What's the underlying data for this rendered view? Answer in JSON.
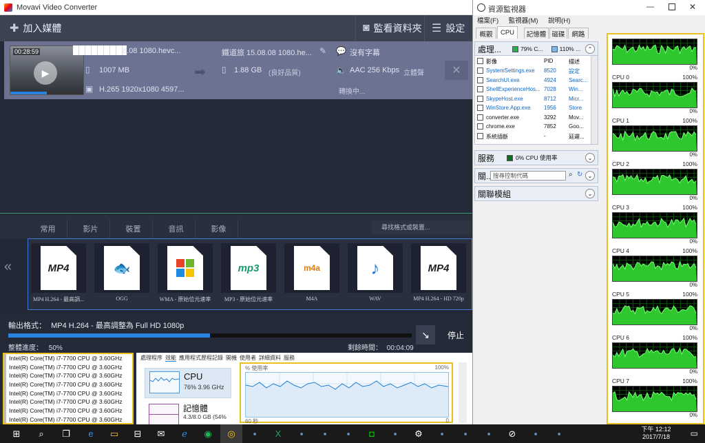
{
  "movavi": {
    "title": "Movavi Video Converter",
    "toolbar": {
      "add_media": "加入媒體",
      "watch_folder": "監看資料夾",
      "settings": "設定"
    },
    "file": {
      "timecode": "00:28:59",
      "source_name": "8.08 1080.hevc...",
      "source_size": "1007 MB",
      "source_codec": "H.265 1920x1080 4597...",
      "target_name": "鐵道旅 15.08.08 1080.he...",
      "target_size": "1.88 GB",
      "target_quality": "(良好品質)",
      "subtitle": "沒有字幕",
      "audio": "AAC 256 Kbps",
      "audio_mode": "立體聲",
      "status": "轉換中..."
    },
    "format_tabs": [
      "常用",
      "影片",
      "裝置",
      "音訊",
      "影像"
    ],
    "format_search": "尋找格式或裝置...",
    "formats": [
      {
        "label": "MP4 H.264 - 最高調...",
        "icon": "mp4-icon"
      },
      {
        "label": "OGG",
        "icon": "ogg-icon"
      },
      {
        "label": "WMA - 原始位元速率",
        "icon": "wma-icon"
      },
      {
        "label": "MP3 - 原始位元速率",
        "icon": "mp3-icon"
      },
      {
        "label": "M4A",
        "icon": "m4a-icon"
      },
      {
        "label": "WAV",
        "icon": "wav-icon"
      },
      {
        "label": "MP4 H.264 - HD 720p",
        "icon": "mp4-icon"
      }
    ],
    "output": {
      "format_label": "輸出格式：",
      "format_value": "MP4 H.264 - 最高調整為 Full HD 1080p",
      "progress_label": "整體進度：",
      "progress_value": "50%",
      "progress": 0.5,
      "remaining_label": "剩餘時間：",
      "remaining_value": "00:04:09",
      "stop": "停止"
    }
  },
  "cpu_list": [
    "Intel(R) Core(TM) i7-7700 CPU @ 3.60GHz",
    "Intel(R) Core(TM) i7-7700 CPU @ 3.60GHz",
    "Intel(R) Core(TM) i7-7700 CPU @ 3.60GHz",
    "Intel(R) Core(TM) i7-7700 CPU @ 3.60GHz",
    "Intel(R) Core(TM) i7-7700 CPU @ 3.60GHz",
    "Intel(R) Core(TM) i7-7700 CPU @ 3.60GHz",
    "Intel(R) Core(TM) i7-7700 CPU @ 3.60GHz",
    "Intel(R) Core(TM) i7-7700 CPU @ 3.60GHz"
  ],
  "task_manager": {
    "tabs": [
      "處理程序",
      "效能",
      "應用程式歷程記錄",
      "開機",
      "使用者",
      "詳細資料",
      "服務"
    ],
    "cpu_label": "CPU",
    "cpu_value": "76% 3.96 GHz",
    "mem_label": "記憶體",
    "mem_value": "4.3/8.0 GB (54%",
    "graph_title": "% 使用率",
    "graph_max": "100%",
    "graph_min": "0",
    "graph_span": "60 秒"
  },
  "resmon": {
    "title": "資源監視器",
    "menu": [
      "檔案(F)",
      "監視器(M)",
      "說明(H)"
    ],
    "tabs": [
      "概觀",
      "CPU",
      "記憶體",
      "磁碟",
      "網路"
    ],
    "processes": {
      "title": "處理...",
      "cpu_pct": "79% C...",
      "freq": "110% ...",
      "headers": [
        "影像",
        "PID",
        "描述"
      ],
      "rows": [
        {
          "name": "SystemSettings.exe",
          "pid": "8520",
          "desc": "設定",
          "link": true
        },
        {
          "name": "SearchUI.exe",
          "pid": "4924",
          "desc": "Searc...",
          "link": true
        },
        {
          "name": "ShellExperienceHos...",
          "pid": "7028",
          "desc": "Win...",
          "link": true
        },
        {
          "name": "SkypeHost.exe",
          "pid": "8712",
          "desc": "Micr...",
          "link": true
        },
        {
          "name": "WinStore.App.exe",
          "pid": "1956",
          "desc": "Store",
          "link": true
        },
        {
          "name": "converter.exe",
          "pid": "3292",
          "desc": "Mov...",
          "link": false
        },
        {
          "name": "chrome.exe",
          "pid": "7852",
          "desc": "Goo...",
          "link": false
        },
        {
          "name": "系統插斷",
          "pid": "-",
          "desc": "延遲...",
          "link": false
        }
      ]
    },
    "services": {
      "title": "服務",
      "cpu": "0% CPU 使用率"
    },
    "handles": {
      "title": "關...",
      "placeholder": "搜尋控制代碼"
    },
    "modules": {
      "title": "關聯模組"
    },
    "cpu_graphs": [
      {
        "label": "",
        "max": "",
        "min": "0%"
      },
      {
        "label": "CPU 0",
        "max": "100%",
        "min": "0%"
      },
      {
        "label": "CPU 1",
        "max": "100%",
        "min": "0%"
      },
      {
        "label": "CPU 2",
        "max": "100%",
        "min": "0%"
      },
      {
        "label": "CPU 3",
        "max": "100%",
        "min": "0%"
      },
      {
        "label": "CPU 4",
        "max": "100%",
        "min": "0%"
      },
      {
        "label": "CPU 5",
        "max": "100%",
        "min": "0%"
      },
      {
        "label": "CPU 6",
        "max": "100%",
        "min": "0%"
      },
      {
        "label": "CPU 7",
        "max": "100%",
        "min": "0%"
      }
    ]
  },
  "taskbar": {
    "time": "下午 12:12",
    "date": "2017/7/18",
    "icons": [
      "start-icon",
      "search-icon",
      "task-view-icon",
      "edge-icon",
      "file-explorer-icon",
      "store-icon",
      "mail-icon",
      "ie-icon",
      "spotify-icon",
      "chrome-icon",
      "app-icon",
      "excel-icon",
      "app-icon",
      "app-icon",
      "app-icon",
      "line-icon",
      "app-icon",
      "settings-icon",
      "app-icon",
      "app-icon",
      "app-icon",
      "resmon-icon",
      "app-icon",
      "app-icon"
    ]
  }
}
